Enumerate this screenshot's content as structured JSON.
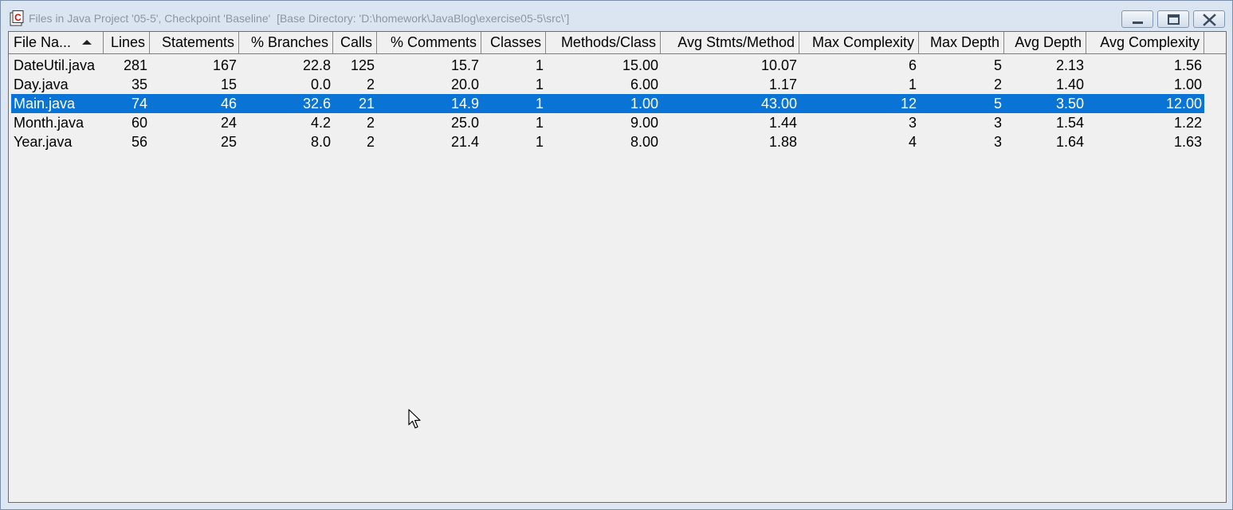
{
  "window": {
    "title": "Files in Java Project '05-5', Checkpoint 'Baseline'  [Base Directory: 'D:\\homework\\JavaBlog\\exercise05-5\\src\\']",
    "icon": "app-c-icon",
    "buttons": [
      "minimize-icon",
      "maximize-icon",
      "close-icon"
    ]
  },
  "table": {
    "columns": [
      "File Na...",
      "Lines",
      "Statements",
      "% Branches",
      "Calls",
      "% Comments",
      "Classes",
      "Methods/Class",
      "Avg Stmts/Method",
      "Max Complexity",
      "Max Depth",
      "Avg Depth",
      "Avg Complexity"
    ],
    "sorted_column": "File Na...",
    "sort_indicator": "sort-ascending-icon",
    "rows": [
      [
        "DateUtil.java",
        "281",
        "167",
        "22.8",
        "125",
        "15.7",
        "1",
        "15.00",
        "10.07",
        "6",
        "5",
        "2.13",
        "1.56"
      ],
      [
        "Day.java",
        "35",
        "15",
        "0.0",
        "2",
        "20.0",
        "1",
        "6.00",
        "1.17",
        "1",
        "2",
        "1.40",
        "1.00"
      ],
      [
        "Main.java",
        "74",
        "46",
        "32.6",
        "21",
        "14.9",
        "1",
        "1.00",
        "43.00",
        "12",
        "5",
        "3.50",
        "12.00"
      ],
      [
        "Month.java",
        "60",
        "24",
        "4.2",
        "2",
        "25.0",
        "1",
        "9.00",
        "1.44",
        "3",
        "3",
        "1.54",
        "1.22"
      ],
      [
        "Year.java",
        "56",
        "25",
        "8.0",
        "2",
        "21.4",
        "1",
        "8.00",
        "1.88",
        "4",
        "3",
        "1.64",
        "1.63"
      ]
    ],
    "selected_row": "Main.java",
    "selection_color": "#0a74d6"
  }
}
